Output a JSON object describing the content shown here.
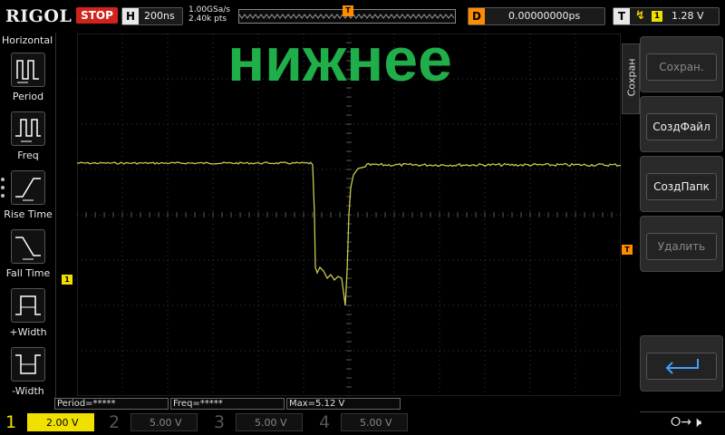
{
  "topbar": {
    "brand": "RIGOL",
    "run_state": "STOP",
    "timebase_tag": "H",
    "timebase": "200ns",
    "sample_rate": "1.00GSa/s",
    "memory_depth": "2.40k pts",
    "trigger_marker_tag": "T",
    "delay_tag": "D",
    "delay": "0.00000000ps",
    "trigger_tag": "T",
    "trigger_source": "1",
    "trigger_level": "1.28 V"
  },
  "left_panel": {
    "title": "Horizontal",
    "items": [
      {
        "label": "Period",
        "icon": "period-icon"
      },
      {
        "label": "Freq",
        "icon": "frequency-icon"
      },
      {
        "label": "Rise Time",
        "icon": "rise-time-icon"
      },
      {
        "label": "Fall Time",
        "icon": "fall-time-icon"
      },
      {
        "label": "+Width",
        "icon": "positive-width-icon"
      },
      {
        "label": "-Width",
        "icon": "negative-width-icon"
      }
    ]
  },
  "overlay_text": "нижнее",
  "overlay_color": "#1fae4a",
  "screen": {
    "ch1_marker": "1",
    "trigger_level_marker": "T",
    "trace_color": "#c8c850",
    "grid_color": "#3a3a3a"
  },
  "right_menu": {
    "tab": "Сохран",
    "buttons": [
      {
        "label": "Сохран.",
        "enabled": false
      },
      {
        "label": "СоздФайл",
        "enabled": true
      },
      {
        "label": "СоздПапк",
        "enabled": true
      },
      {
        "label": "Удалить",
        "enabled": false
      }
    ],
    "back_icon": "return-arrow-icon"
  },
  "measurements": {
    "period": "Period=*****",
    "freq": "Freq=*****",
    "max": "Max=5.12 V"
  },
  "channels": [
    {
      "num": "1",
      "scale": "2.00 V",
      "color": "#f0e000",
      "active": true
    },
    {
      "num": "2",
      "scale": "5.00 V",
      "color": "#00c0c0",
      "active": false
    },
    {
      "num": "3",
      "scale": "5.00 V",
      "color": "#d040d0",
      "active": false
    },
    {
      "num": "4",
      "scale": "5.00 V",
      "color": "#3a7fff",
      "active": false
    }
  ],
  "status_icons": [
    "usb-icon",
    "speaker-mute-icon"
  ]
}
